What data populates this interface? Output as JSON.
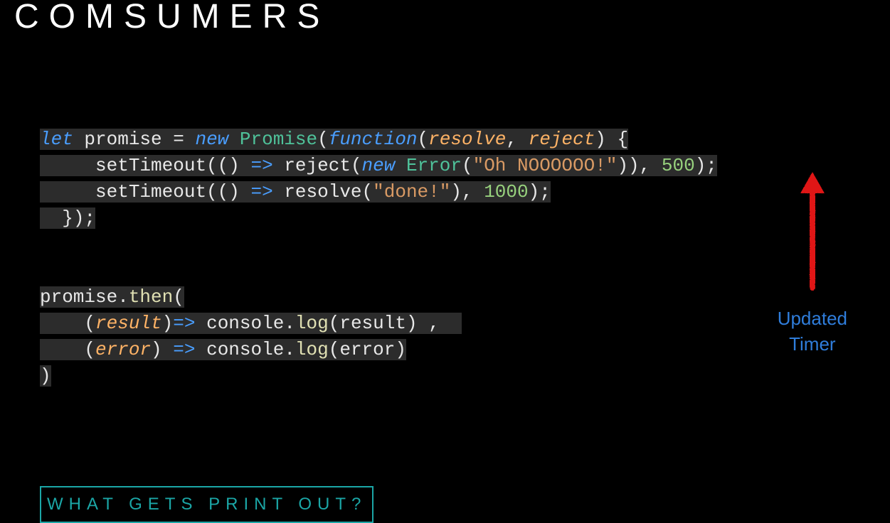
{
  "title": "COMSUMERS",
  "code": {
    "tokens": {
      "let": "let",
      "promise": "promise",
      "eq": "=",
      "new": "new",
      "PromiseClass": "Promise",
      "function": "function",
      "resolve": "resolve",
      "reject": "reject",
      "setTimeout": "setTimeout",
      "ErrorClass": "Error",
      "errStr": "\"Oh NOOOOOO!\"",
      "delay1": "500",
      "doneStr": "\"done!\"",
      "delay2": "1000",
      "then": "then",
      "result": "result",
      "console": "console",
      "log": "log",
      "error": "error",
      "comma": ",",
      "semi": ";",
      "dot": ".",
      "lparen": "(",
      "rparen": ")",
      "lbrace": "{",
      "rbrace": "}",
      "arrow": "=>"
    }
  },
  "annotation": {
    "line1": "Updated",
    "line2": "Timer"
  },
  "question": "WHAT GETS PRINT OUT?"
}
